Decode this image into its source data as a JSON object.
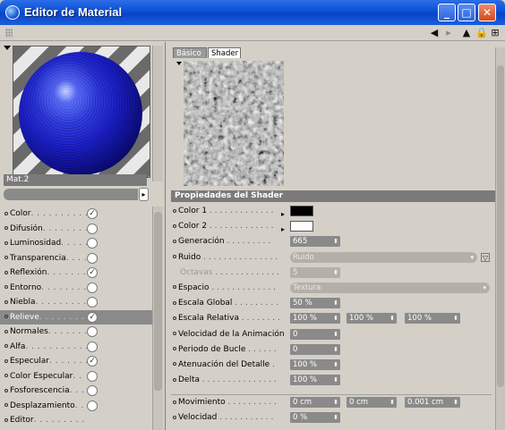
{
  "window": {
    "title": "Editor de Material"
  },
  "toolbar": {
    "back": "◀",
    "forward": "▸",
    "up": "▲",
    "lock": "🔒",
    "new_window": "⊞"
  },
  "preview": {
    "material_name": "Mat.2"
  },
  "channels": [
    {
      "label": "Color",
      "checked": true
    },
    {
      "label": "Difusión",
      "checked": false
    },
    {
      "label": "Luminosidad",
      "checked": false
    },
    {
      "label": "Transparencia",
      "checked": false
    },
    {
      "label": "Reflexión",
      "checked": true
    },
    {
      "label": "Entorno",
      "checked": false
    },
    {
      "label": "Niebla",
      "checked": false
    },
    {
      "label": "Relieve",
      "checked": true,
      "selected": true
    },
    {
      "label": "Normales",
      "checked": false
    },
    {
      "label": "Alfa",
      "checked": false
    },
    {
      "label": "Especular",
      "checked": true
    },
    {
      "label": "Color Especular",
      "checked": false
    },
    {
      "label": "Fosforescencia",
      "checked": false
    },
    {
      "label": "Desplazamiento",
      "checked": false
    },
    {
      "label": "Editor",
      "checked": false
    }
  ],
  "tabs": {
    "basic": "Básico",
    "shader": "Shader"
  },
  "shader": {
    "section_title": "Propiedades del Shader",
    "color1_label": "Color 1",
    "color1": "#000000",
    "color2_label": "Color 2",
    "color2": "#ffffff",
    "generacion_label": "Generación",
    "generacion": "665",
    "ruido_label": "Ruido",
    "ruido": "Ruido",
    "octavas_label": "Octavas",
    "octavas": "5",
    "espacio_label": "Espacio",
    "espacio": "Textura",
    "escala_global_label": "Escala Global",
    "escala_global": "50 %",
    "escala_relativa_label": "Escala Relativa",
    "escala_relativa": [
      "100 %",
      "100 %",
      "100 %"
    ],
    "velocidad_anim_label": "Velocidad de la Animación",
    "velocidad_anim": "0",
    "periodo_bucle_label": "Periodo de Bucle",
    "periodo_bucle": "0",
    "atenuacion_label": "Atenuación del Detalle",
    "atenuacion": "100 %",
    "delta_label": "Delta",
    "delta": "100 %",
    "movimiento_label": "Movimiento",
    "movimiento": [
      "0 cm",
      "0 cm",
      "0.001 cm"
    ],
    "velocidad_label": "Velocidad",
    "velocidad": "0 %"
  }
}
